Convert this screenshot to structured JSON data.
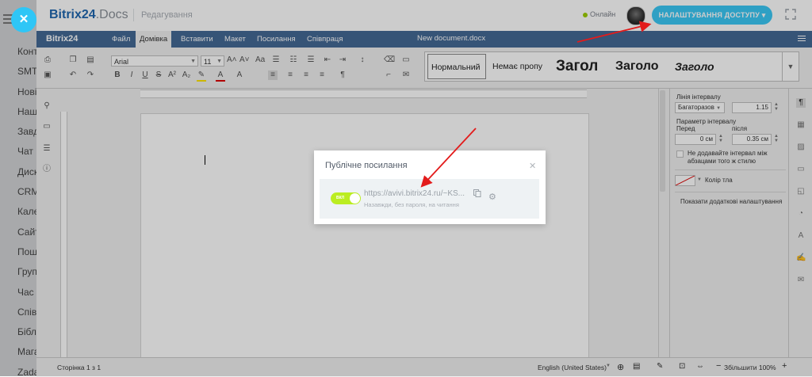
{
  "sidebar": {
    "items": [
      "Конт",
      "SMT",
      "Нові",
      "Наш",
      "Завд",
      "Чат",
      "Диск",
      "CRM",
      "Кале",
      "Сайт",
      "Поша",
      "Груп",
      "Час",
      "Спів",
      "Бібл",
      "Мага",
      "Zada"
    ]
  },
  "header": {
    "logo_main": "Bitrix24",
    "logo_docs": ".Docs",
    "mode": "Редагування",
    "online": "Онлайн",
    "access_button": "НАЛАШТУВАННЯ ДОСТУПУ"
  },
  "editor": {
    "brand": "Bitrix24",
    "tabs": [
      "Файл",
      "Домівка",
      "Вставити",
      "Макет",
      "Посилання",
      "Співпраця"
    ],
    "active_tab": "Домівка",
    "doc_title": "New document.docx",
    "font_name": "Arial",
    "font_size": "11",
    "styles": [
      "Нормальний",
      "Немає пропу",
      "Загол",
      "Заголо",
      "Заголо"
    ]
  },
  "paragraph_panel": {
    "line_spacing_label": "Лінія інтервалу",
    "line_spacing_type": "Багаторазов",
    "line_spacing_value": "1.15",
    "param_label": "Параметр інтервалу",
    "before_label": "Перед",
    "after_label": "після",
    "before_value": "0 см",
    "after_value": "0.35 см",
    "no_spacing_checkbox": "Не додавайте інтервал між абзацами того ж стилю",
    "bg_color_label": "Колір тла",
    "advanced_link": "Показати додаткові налаштування"
  },
  "statusbar": {
    "page_info": "Сторінка 1 з 1",
    "language": "English (United States)",
    "zoom": "Збільшити 100%"
  },
  "dialog": {
    "title": "Публічне посилання",
    "toggle_text": "ВКЛ",
    "toggle_on": true,
    "url": "https://avivi.bitrix24.ru/~KS...",
    "hint": "Назавжди, без пароля, на читання"
  }
}
